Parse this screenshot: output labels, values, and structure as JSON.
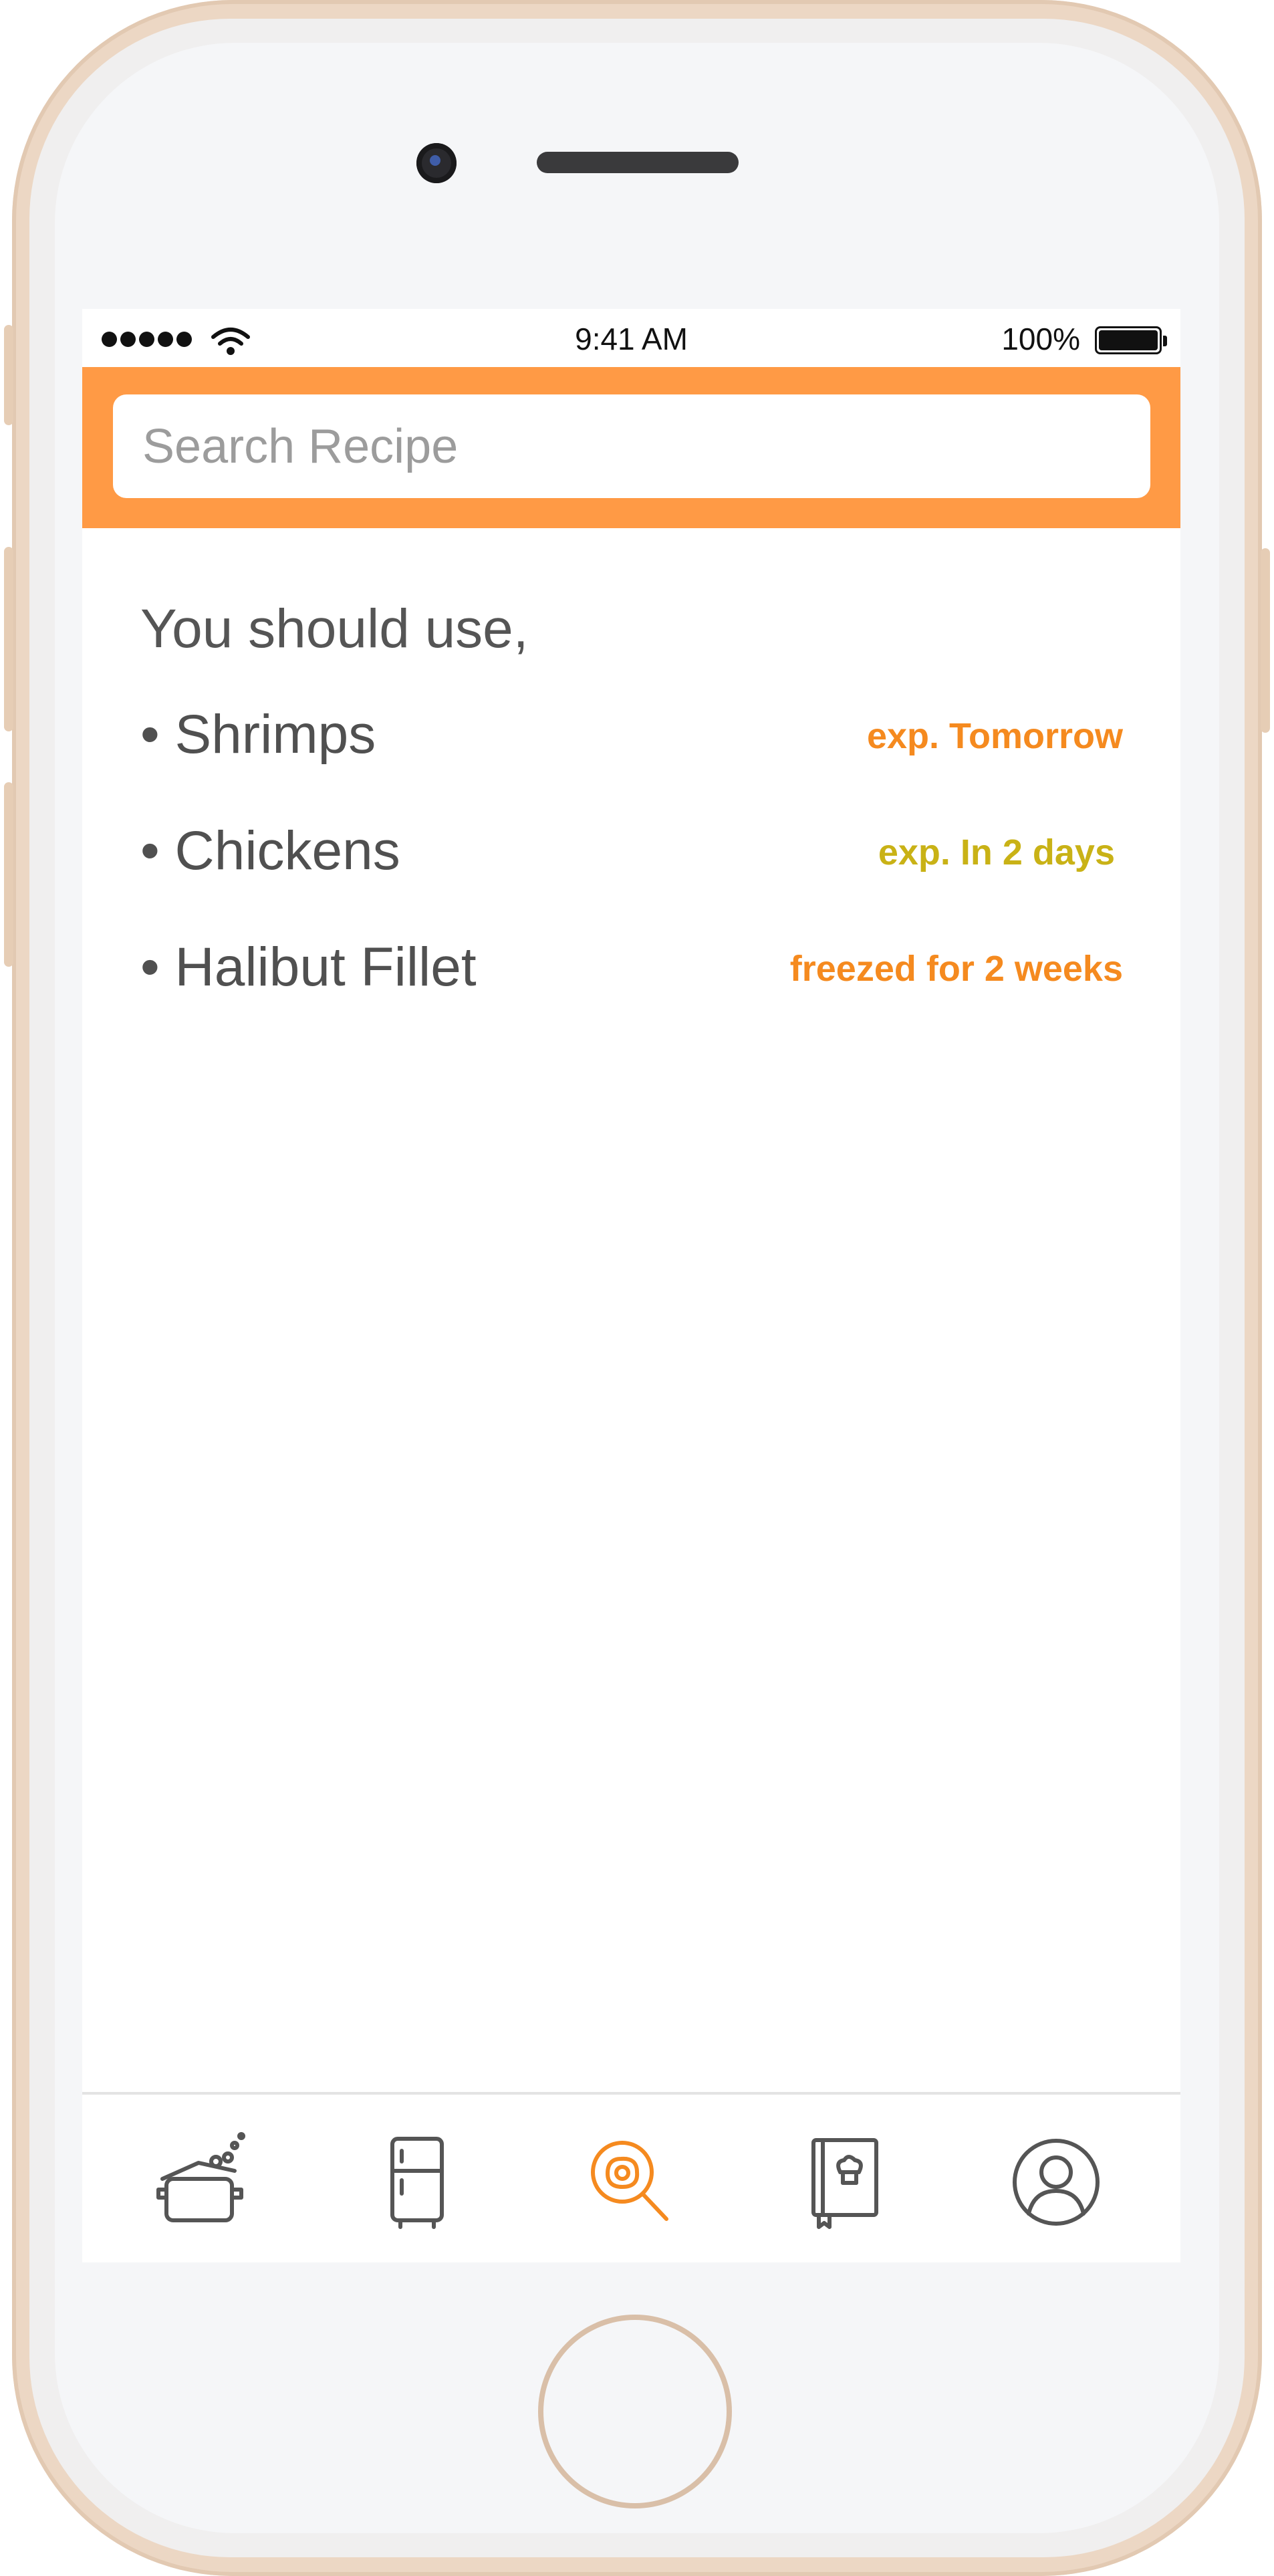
{
  "status_bar": {
    "time": "9:41 AM",
    "battery_percent": "100%",
    "signal_icon": "signal-dots-icon",
    "wifi_icon": "wifi-icon",
    "battery_icon": "battery-icon"
  },
  "search": {
    "placeholder": "Search Recipe",
    "value": ""
  },
  "main": {
    "intro": "You should use,",
    "items": [
      {
        "name": "• Shrimps",
        "status": "exp. Tomorrow",
        "status_color": "#f58a1f"
      },
      {
        "name": "• Chickens",
        "status": "exp. In 2 days",
        "status_color": "#c9b216"
      },
      {
        "name": "• Halibut Fillet",
        "status": "freezed for 2 weeks",
        "status_color": "#f58a1f"
      }
    ]
  },
  "tab_bar": {
    "tabs": [
      {
        "icon": "cooking-pot-icon",
        "active": false
      },
      {
        "icon": "fridge-icon",
        "active": false
      },
      {
        "icon": "search-recipe-icon",
        "active": true
      },
      {
        "icon": "cookbook-icon",
        "active": false
      },
      {
        "icon": "profile-icon",
        "active": false
      }
    ],
    "active_color": "#f58a1f",
    "inactive_color": "#555555"
  },
  "colors": {
    "accent": "#ff9a45",
    "phone_frame": "#ecd7c4"
  }
}
